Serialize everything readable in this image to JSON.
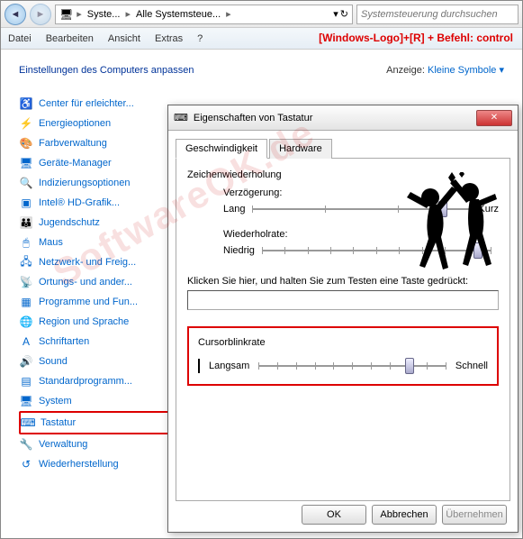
{
  "nav": {
    "back": "◄",
    "fwd": "►"
  },
  "breadcrumb": {
    "root_icon": "🖥",
    "seg1": "Syste...",
    "seg2": "Alle Systemsteue...",
    "refresh": "↻"
  },
  "search": {
    "placeholder": "Systemsteuerung durchsuchen"
  },
  "menu": {
    "file": "Datei",
    "edit": "Bearbeiten",
    "view": "Ansicht",
    "extras": "Extras",
    "help": "?"
  },
  "hint": "[Windows-Logo]+[R] + Befehl: control",
  "heading": "Einstellungen des Computers anpassen",
  "view_label": "Anzeige:",
  "view_value": "Kleine Symbole ▾",
  "items": [
    {
      "icon": "♿",
      "label": "Center für erleichter..."
    },
    {
      "icon": "⚡",
      "label": "Energieoptionen"
    },
    {
      "icon": "🎨",
      "label": "Farbverwaltung"
    },
    {
      "icon": "🖥",
      "label": "Geräte-Manager"
    },
    {
      "icon": "🔍",
      "label": "Indizierungsoptionen"
    },
    {
      "icon": "▣",
      "label": "Intel® HD-Grafik..."
    },
    {
      "icon": "👪",
      "label": "Jugendschutz"
    },
    {
      "icon": "🖱",
      "label": "Maus"
    },
    {
      "icon": "🖧",
      "label": "Netzwerk- und Freig..."
    },
    {
      "icon": "📡",
      "label": "Ortungs- und ander..."
    },
    {
      "icon": "▦",
      "label": "Programme und Fun..."
    },
    {
      "icon": "🌐",
      "label": "Region und Sprache"
    },
    {
      "icon": "A",
      "label": "Schriftarten"
    },
    {
      "icon": "🔊",
      "label": "Sound"
    },
    {
      "icon": "▤",
      "label": "Standardprogramm..."
    },
    {
      "icon": "🖥",
      "label": "System"
    },
    {
      "icon": "⌨",
      "label": "Tastatur"
    },
    {
      "icon": "🔧",
      "label": "Verwaltung"
    },
    {
      "icon": "↺",
      "label": "Wiederherstellung"
    }
  ],
  "dialog": {
    "icon": "⌨",
    "title": "Eigenschaften von Tastatur",
    "close": "✕",
    "tab1": "Geschwindigkeit",
    "tab2": "Hardware",
    "group1": "Zeichenwiederholung",
    "delay_label": "Verzögerung:",
    "delay_min": "Lang",
    "delay_max": "Kurz",
    "rate_label": "Wiederholrate:",
    "rate_min": "Niedrig",
    "rate_max": "",
    "test_label": "Klicken Sie hier, und halten Sie zum Testen eine Taste gedrückt:",
    "group2": "Cursorblinkrate",
    "blink_min": "Langsam",
    "blink_max": "Schnell",
    "ok": "OK",
    "cancel": "Abbrechen",
    "apply": "Übernehmen"
  },
  "watermark": "SoftwareOK.de"
}
